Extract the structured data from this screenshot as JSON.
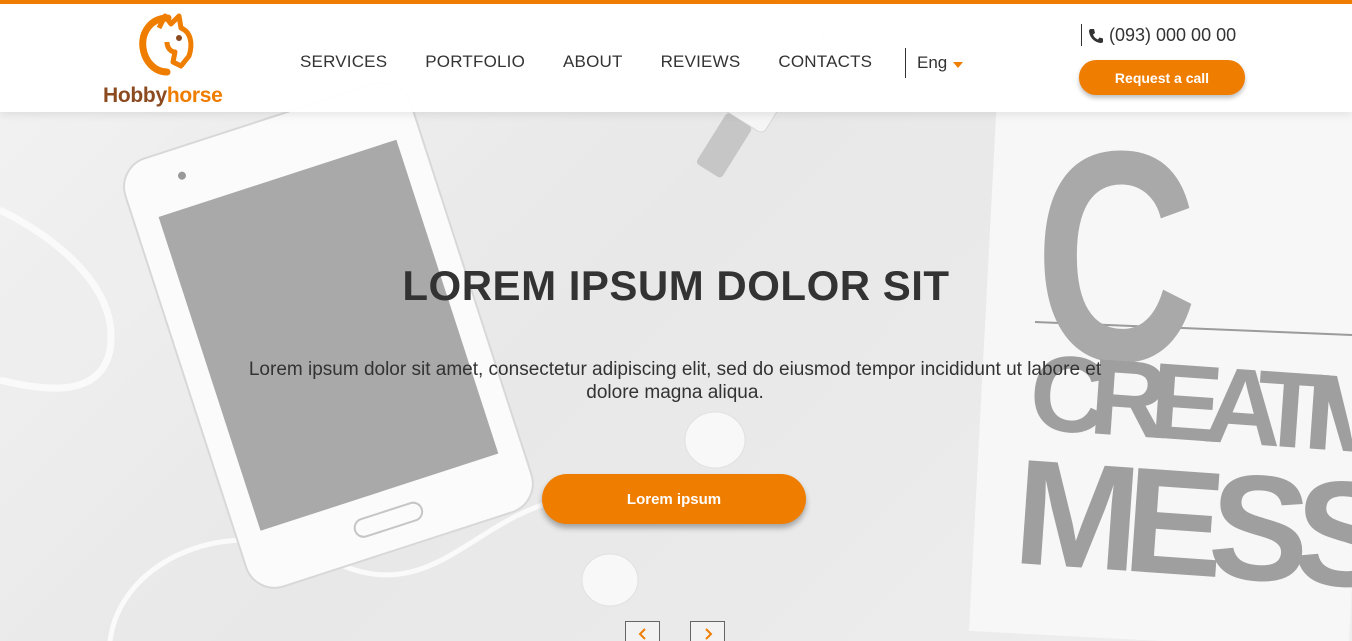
{
  "brand": {
    "name_part1": "Hobby",
    "name_part2": "horse",
    "logo_icon": "horse-head-icon",
    "accent_color": "#ef7d00",
    "brown_color": "#8b4a1f"
  },
  "nav": {
    "items": [
      {
        "label": "SERVICES"
      },
      {
        "label": "PORTFOLIO"
      },
      {
        "label": "ABOUT"
      },
      {
        "label": "REVIEWS"
      },
      {
        "label": "CONTACTS"
      }
    ],
    "language": "Eng"
  },
  "header": {
    "phone_icon": "phone-icon",
    "phone": "(093) 000 00 00",
    "request_call_label": "Request a call"
  },
  "hero": {
    "title": "LOREM IPSUM DOLOR SIT",
    "subtitle": "Lorem ipsum dolor sit amet, consectetur adipiscing elit, sed do eiusmod tempor incididunt ut labore et dolore magna aliqua.",
    "button_label": "Lorem ipsum",
    "background_text_1": "CREATIV",
    "background_text_2": "MESS",
    "background_letter": "C"
  },
  "slider": {
    "prev_icon": "chevron-left-icon",
    "next_icon": "chevron-right-icon"
  }
}
